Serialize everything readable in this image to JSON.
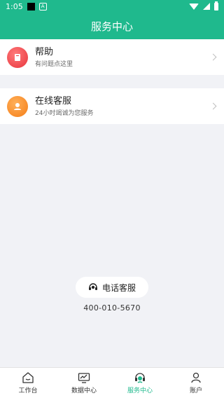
{
  "status_bar": {
    "time": "1:05",
    "badge_text": "A"
  },
  "header": {
    "title": "服务中心"
  },
  "menu": [
    {
      "title": "帮助",
      "subtitle": "有问题点这里",
      "icon": "help-book-icon",
      "color": "#E8333B"
    },
    {
      "title": "在线客服",
      "subtitle": "24小时竭诚为您服务",
      "icon": "customer-service-person-icon",
      "color": "#F57D16"
    }
  ],
  "contact": {
    "button_label": "电话客服",
    "phone": "400-010-5670"
  },
  "tabs": [
    {
      "label": "工作台",
      "icon": "home-icon",
      "active": false
    },
    {
      "label": "数据中心",
      "icon": "chart-monitor-icon",
      "active": false
    },
    {
      "label": "服务中心",
      "icon": "headset-icon",
      "active": true
    },
    {
      "label": "账户",
      "icon": "user-icon",
      "active": false
    }
  ],
  "colors": {
    "accent": "#1FB98D",
    "background": "#F1F2F6"
  }
}
